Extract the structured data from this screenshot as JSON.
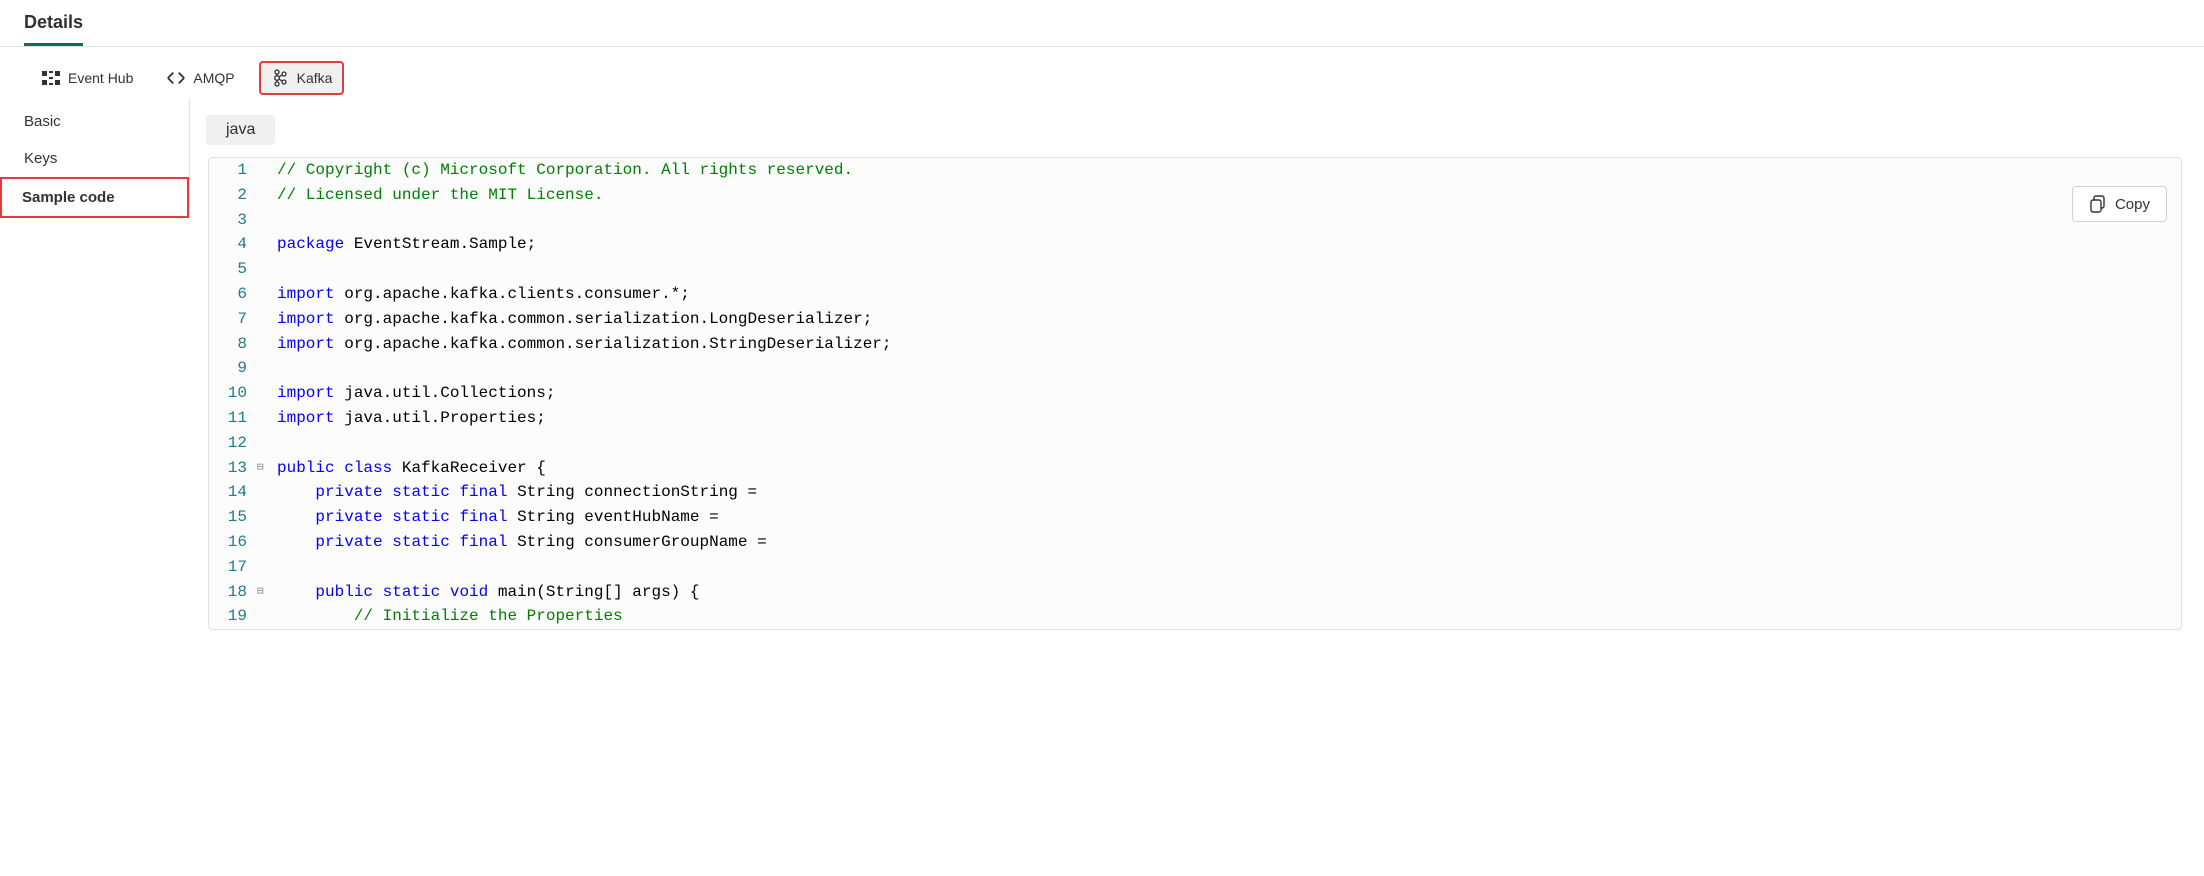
{
  "header": {
    "tab": "Details"
  },
  "protocols": {
    "items": [
      {
        "label": "Event Hub",
        "icon": "eventhub-icon",
        "active": false
      },
      {
        "label": "AMQP",
        "icon": "amqp-icon",
        "active": false
      },
      {
        "label": "Kafka",
        "icon": "kafka-icon",
        "active": true,
        "highlighted": true
      }
    ]
  },
  "sidebar": {
    "items": [
      {
        "label": "Basic",
        "active": false
      },
      {
        "label": "Keys",
        "active": false
      },
      {
        "label": "Sample code",
        "active": true,
        "highlighted": true
      }
    ]
  },
  "language": {
    "selected": "java"
  },
  "copy_button": {
    "label": "Copy"
  },
  "code": {
    "lines": [
      {
        "n": 1,
        "fold": "",
        "tokens": [
          {
            "t": "comment",
            "s": "// Copyright (c) Microsoft Corporation. All rights reserved."
          }
        ]
      },
      {
        "n": 2,
        "fold": "",
        "tokens": [
          {
            "t": "comment",
            "s": "// Licensed under the MIT License."
          }
        ]
      },
      {
        "n": 3,
        "fold": "",
        "tokens": []
      },
      {
        "n": 4,
        "fold": "",
        "tokens": [
          {
            "t": "keyword",
            "s": "package"
          },
          {
            "t": "plain",
            "s": " EventStream.Sample;"
          }
        ]
      },
      {
        "n": 5,
        "fold": "",
        "tokens": []
      },
      {
        "n": 6,
        "fold": "",
        "tokens": [
          {
            "t": "keyword",
            "s": "import"
          },
          {
            "t": "plain",
            "s": " org.apache.kafka.clients.consumer.*;"
          }
        ]
      },
      {
        "n": 7,
        "fold": "",
        "tokens": [
          {
            "t": "keyword",
            "s": "import"
          },
          {
            "t": "plain",
            "s": " org.apache.kafka.common.serialization.LongDeserializer;"
          }
        ]
      },
      {
        "n": 8,
        "fold": "",
        "tokens": [
          {
            "t": "keyword",
            "s": "import"
          },
          {
            "t": "plain",
            "s": " org.apache.kafka.common.serialization.StringDeserializer;"
          }
        ]
      },
      {
        "n": 9,
        "fold": "",
        "tokens": []
      },
      {
        "n": 10,
        "fold": "",
        "tokens": [
          {
            "t": "keyword",
            "s": "import"
          },
          {
            "t": "plain",
            "s": " java.util.Collections;"
          }
        ]
      },
      {
        "n": 11,
        "fold": "",
        "tokens": [
          {
            "t": "keyword",
            "s": "import"
          },
          {
            "t": "plain",
            "s": " java.util.Properties;"
          }
        ]
      },
      {
        "n": 12,
        "fold": "",
        "tokens": []
      },
      {
        "n": 13,
        "fold": "⊟",
        "tokens": [
          {
            "t": "keyword",
            "s": "public"
          },
          {
            "t": "plain",
            "s": " "
          },
          {
            "t": "keyword",
            "s": "class"
          },
          {
            "t": "plain",
            "s": " KafkaReceiver {"
          }
        ]
      },
      {
        "n": 14,
        "fold": "",
        "indent": 1,
        "tokens": [
          {
            "t": "plain",
            "s": "    "
          },
          {
            "t": "keyword",
            "s": "private"
          },
          {
            "t": "plain",
            "s": " "
          },
          {
            "t": "keyword",
            "s": "static"
          },
          {
            "t": "plain",
            "s": " "
          },
          {
            "t": "keyword",
            "s": "final"
          },
          {
            "t": "plain",
            "s": " String connectionString ="
          }
        ]
      },
      {
        "n": 15,
        "fold": "",
        "indent": 1,
        "tokens": [
          {
            "t": "plain",
            "s": "    "
          },
          {
            "t": "keyword",
            "s": "private"
          },
          {
            "t": "plain",
            "s": " "
          },
          {
            "t": "keyword",
            "s": "static"
          },
          {
            "t": "plain",
            "s": " "
          },
          {
            "t": "keyword",
            "s": "final"
          },
          {
            "t": "plain",
            "s": " String eventHubName ="
          }
        ]
      },
      {
        "n": 16,
        "fold": "",
        "indent": 1,
        "tokens": [
          {
            "t": "plain",
            "s": "    "
          },
          {
            "t": "keyword",
            "s": "private"
          },
          {
            "t": "plain",
            "s": " "
          },
          {
            "t": "keyword",
            "s": "static"
          },
          {
            "t": "plain",
            "s": " "
          },
          {
            "t": "keyword",
            "s": "final"
          },
          {
            "t": "plain",
            "s": " String consumerGroupName ="
          }
        ]
      },
      {
        "n": 17,
        "fold": "",
        "indent": 1,
        "tokens": []
      },
      {
        "n": 18,
        "fold": "⊟",
        "indent": 1,
        "tokens": [
          {
            "t": "plain",
            "s": "    "
          },
          {
            "t": "keyword",
            "s": "public"
          },
          {
            "t": "plain",
            "s": " "
          },
          {
            "t": "keyword",
            "s": "static"
          },
          {
            "t": "plain",
            "s": " "
          },
          {
            "t": "keyword",
            "s": "void"
          },
          {
            "t": "plain",
            "s": " main(String[] args) {"
          }
        ]
      },
      {
        "n": 19,
        "fold": "",
        "indent": 2,
        "tokens": [
          {
            "t": "plain",
            "s": "        "
          },
          {
            "t": "comment",
            "s": "// Initialize the Properties"
          }
        ]
      }
    ]
  }
}
